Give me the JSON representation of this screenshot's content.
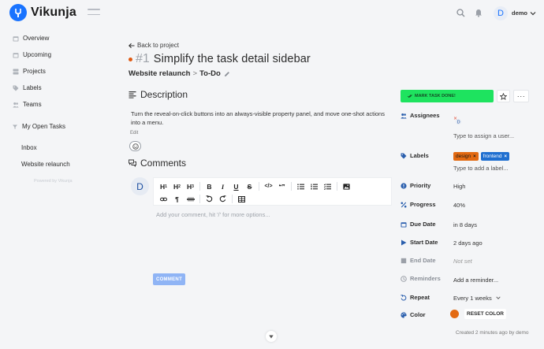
{
  "app": {
    "name": "Vikunja",
    "user": "demo",
    "user_initial": "D",
    "accent_color": "#1973ff"
  },
  "icons": {
    "logo": "vikunja-logo-icon",
    "menu": "hamburger-icon",
    "search": "search-icon",
    "notifications": "bell-icon",
    "user_menu": "chevron-down-icon"
  },
  "sidebar": {
    "items": [
      {
        "label": "Overview",
        "icon": "calendar-icon"
      },
      {
        "label": "Upcoming",
        "icon": "calendar-icon"
      },
      {
        "label": "Projects",
        "icon": "layers-icon"
      },
      {
        "label": "Labels",
        "icon": "tags-icon"
      },
      {
        "label": "Teams",
        "icon": "users-icon"
      }
    ],
    "section": "My Open Tasks",
    "projects": [
      "Inbox",
      "Website relaunch"
    ],
    "powered_by": "Powered by Vikunja"
  },
  "task": {
    "back_label": "Back to project",
    "index": "#1",
    "title": "Simplify the task detail sidebar",
    "project": "Website relaunch",
    "separator": ">",
    "bucket": "To-Do",
    "color": "#e05a12",
    "description_heading": "Description",
    "description": "Turn the reveal-on-click buttons into an always-visible property panel, and move one-shot actions into a menu.",
    "edit_label": "Edit",
    "comments_heading": "Comments",
    "comment_author_initial": "D",
    "comment_placeholder": "Add your comment, hit '/' for more options...",
    "comment_button": "COMMENT",
    "created_meta": "Created 2 minutes ago by demo"
  },
  "toolbar": {
    "row1": [
      "H1",
      "H2",
      "H3",
      "B",
      "I",
      "U",
      "S",
      "</>",
      "99",
      "bullet-list",
      "ordered-list",
      "task-list",
      "image"
    ],
    "heading": {
      "h": "H",
      "one": "1",
      "two": "2",
      "three": "3"
    },
    "bold": "B",
    "italic": "I",
    "underline": "U",
    "strike": "S",
    "code": "</>",
    "quote": "❝❞",
    "paragraph": "¶"
  },
  "actions": {
    "done_label": "MARK TASK DONE!",
    "done_color": "#1ee35f",
    "more_label": "···"
  },
  "properties": {
    "assignees": {
      "label": "Assignees",
      "placeholder": "Type to assign a user..."
    },
    "labels": {
      "label": "Labels",
      "tags": [
        {
          "name": "design",
          "color": "#e36a12",
          "text_color": "#1a1a1a"
        },
        {
          "name": "frontend",
          "color": "#1f6fd0",
          "text_color": "#ffffff"
        }
      ],
      "placeholder": "Type to add a label..."
    },
    "priority": {
      "label": "Priority",
      "value": "High"
    },
    "progress": {
      "label": "Progress",
      "value": "40%"
    },
    "due_date": {
      "label": "Due Date",
      "value": "in 8 days"
    },
    "start_date": {
      "label": "Start Date",
      "value": "2 days ago"
    },
    "end_date": {
      "label": "End Date",
      "value": "Not set"
    },
    "reminders": {
      "label": "Reminders",
      "value": "Add a reminder..."
    },
    "repeat": {
      "label": "Repeat",
      "value": "Every 1 weeks"
    },
    "color": {
      "label": "Color",
      "value": "#e36a12",
      "reset_label": "RESET COLOR"
    }
  }
}
